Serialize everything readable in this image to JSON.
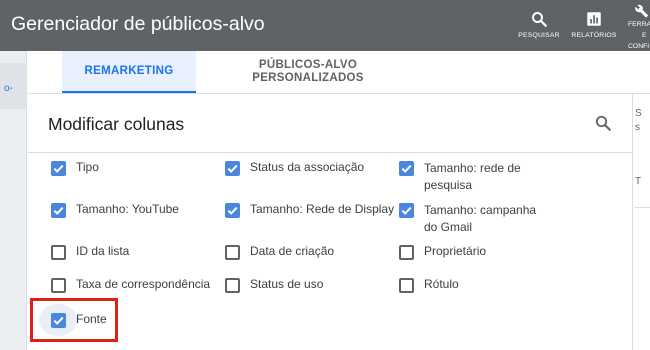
{
  "app": {
    "title": "Gerenciador de públicos-alvo"
  },
  "toolbar": {
    "search_label": "PESQUISAR",
    "reports_label": "RELATÓRIOS",
    "tools_label_line1": "FERRA",
    "tools_label_line2": "E",
    "tools_label_line3": "CONFI"
  },
  "leftnav": {
    "selected_label": "o-"
  },
  "tabs": [
    {
      "label": "REMARKETING",
      "active": true
    },
    {
      "label": "PÚBLICOS-ALVO PERSONALIZADOS",
      "active": false
    }
  ],
  "modify": {
    "title": "Modificar colunas",
    "options": [
      {
        "label": "Tipo",
        "checked": true
      },
      {
        "label": "Status da associação",
        "checked": true
      },
      {
        "label": "Tamanho: rede de pesquisa",
        "checked": true
      },
      {
        "label": "Tamanho: YouTube",
        "checked": true
      },
      {
        "label": "Tamanho: Rede de Display",
        "checked": true
      },
      {
        "label": "Tamanho: campanha do Gmail",
        "checked": true
      },
      {
        "label": "ID da lista",
        "checked": false
      },
      {
        "label": "Data de criação",
        "checked": false
      },
      {
        "label": "Proprietário",
        "checked": false
      },
      {
        "label": "Taxa de correspondência",
        "checked": false
      },
      {
        "label": "Status de uso",
        "checked": false
      },
      {
        "label": "Rótulo",
        "checked": false
      },
      {
        "label": "Fonte",
        "checked": true
      }
    ]
  },
  "rightpanel": {
    "char1": "S",
    "char2": "s",
    "char3": "T"
  },
  "colors": {
    "topbar": "#5f6368",
    "accent": "#1a73e8",
    "checkbox": "#4a86e0",
    "highlight": "#e0201b"
  }
}
